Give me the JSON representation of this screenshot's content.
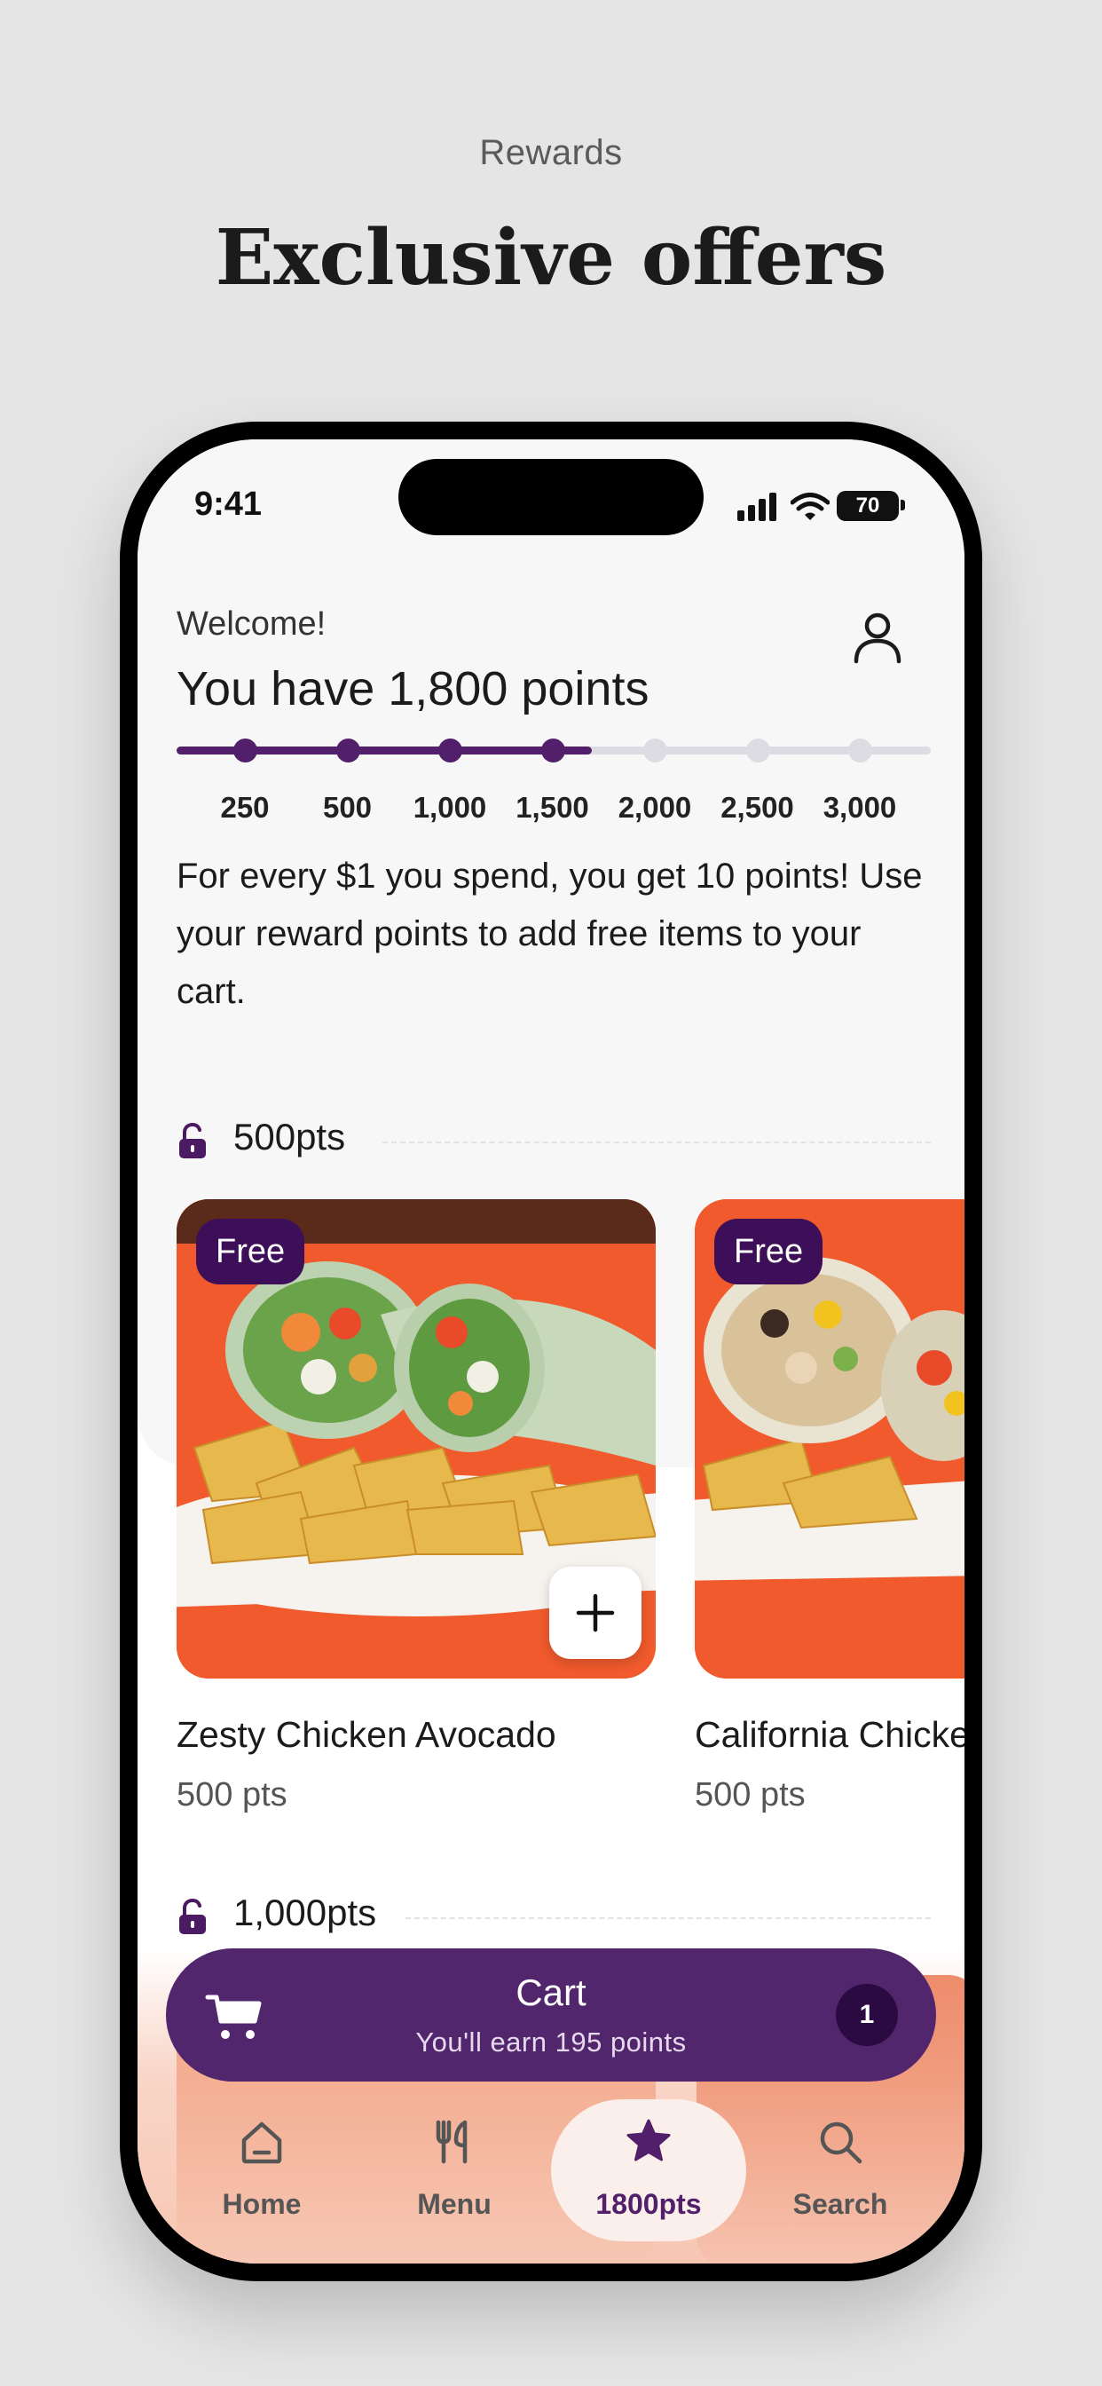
{
  "page": {
    "eyebrow": "Rewards",
    "title": "Exclusive offers"
  },
  "status_bar": {
    "time": "9:41",
    "battery": "70"
  },
  "header": {
    "welcome": "Welcome!",
    "points_title": "You have 1,800 points",
    "profile_icon": "person-icon"
  },
  "progress": {
    "current_points": 1800,
    "milestones": [
      "250",
      "500",
      "1,000",
      "1,500",
      "2,000",
      "2,500",
      "3,000"
    ],
    "reached_count": 4,
    "fill_fraction": 0.55,
    "accent": "#52206a"
  },
  "info": {
    "text": "For every $1 you spend, you get 10 points! Use your reward points to add free items to your cart."
  },
  "tiers": [
    {
      "label": "500pts",
      "items": [
        {
          "badge": "Free",
          "name": "Zesty Chicken Avocado",
          "points": "500 pts"
        },
        {
          "badge": "Free",
          "name": "California Chicke",
          "points": "500 pts"
        }
      ]
    },
    {
      "label": "1,000pts"
    }
  ],
  "cart": {
    "title": "Cart",
    "subtitle": "You'll earn 195 points",
    "count": "1"
  },
  "tabbar": {
    "home": "Home",
    "menu": "Menu",
    "rewards": "1800pts",
    "search": "Search"
  }
}
